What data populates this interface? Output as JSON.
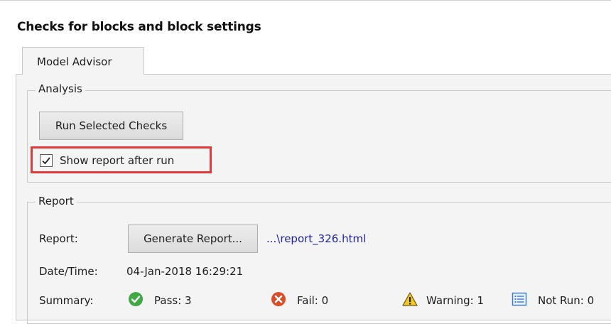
{
  "page": {
    "title": "Checks for blocks and block settings"
  },
  "tabs": [
    {
      "label": "Model Advisor"
    }
  ],
  "analysis": {
    "legend": "Analysis",
    "run_button_label": "Run Selected Checks",
    "show_report_label": "Show report after run",
    "show_report_checked": true
  },
  "report": {
    "legend": "Report",
    "report_label": "Report:",
    "generate_button_label": "Generate Report...",
    "report_link": "...\\report_326.html",
    "datetime_label": "Date/Time:",
    "datetime_value": "04-Jan-2018 16:29:21",
    "summary_label": "Summary:",
    "summary": {
      "pass": "Pass: 3",
      "fail": "Fail: 0",
      "warning": "Warning: 1",
      "not_run": "Not Run: 0"
    }
  },
  "colors": {
    "pass": "#41a845",
    "fail": "#dd4d2a",
    "warning": "#f3c623",
    "not_run": "#3b78c4",
    "highlight": "#e03a3a",
    "link": "#2323a8"
  },
  "icons": {
    "pass": "check-circle-icon",
    "fail": "x-circle-icon",
    "warning": "warning-triangle-icon",
    "not_run": "list-icon",
    "checkbox": "checkmark-icon"
  }
}
